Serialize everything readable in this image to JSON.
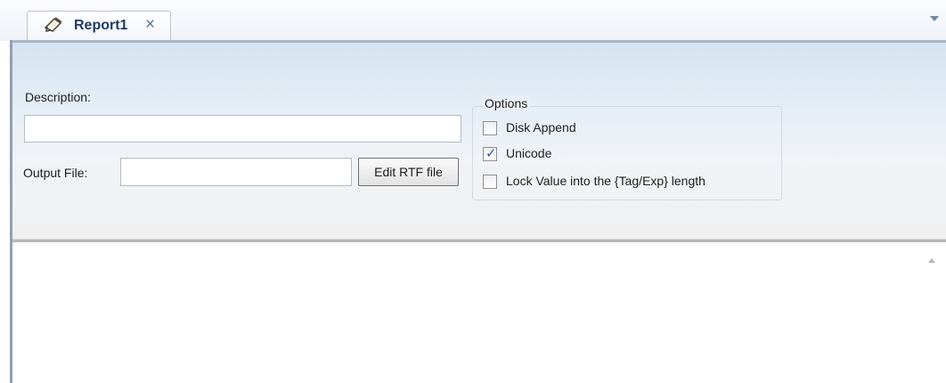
{
  "tab": {
    "icon": "report-pen-icon",
    "label": "Report1",
    "close_glyph": "×"
  },
  "form": {
    "description_label": "Description:",
    "description_value": "",
    "output_file_label": "Output File:",
    "output_file_value": "",
    "edit_rtf_button": "Edit RTF file"
  },
  "options": {
    "title": "Options",
    "items": [
      {
        "label": "Disk Append",
        "checked": false
      },
      {
        "label": "Unicode",
        "checked": true
      },
      {
        "label": "Lock Value into the {Tag/Exp} length",
        "checked": false
      }
    ]
  },
  "editor": {
    "content": ""
  }
}
